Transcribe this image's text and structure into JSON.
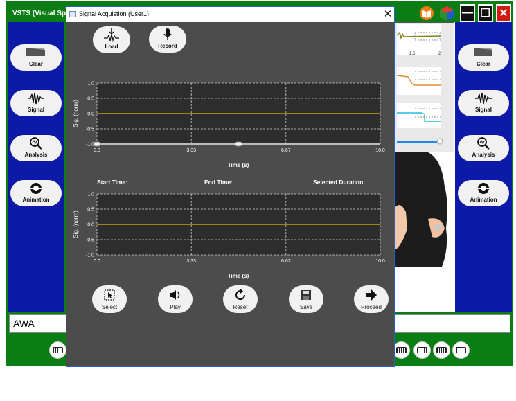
{
  "app": {
    "title": "VSTS (Visual Spee",
    "window_buttons": {
      "help_icon": "book-icon",
      "cube_icon": "cube-icon",
      "min_glyph": "—",
      "max_glyph": "❐",
      "close_glyph": "✕"
    },
    "side_buttons": [
      {
        "label": "Clear",
        "icon": "eraser-icon"
      },
      {
        "label": "Signal",
        "icon": "waveform-icon"
      },
      {
        "label": "Analysis",
        "icon": "magnifier-icon"
      },
      {
        "label": "Animation",
        "icon": "film-icon"
      }
    ],
    "text_box": {
      "value": "AWA"
    },
    "visualization": {
      "tick_labels": [
        "1.6",
        "2"
      ]
    }
  },
  "dialog": {
    "title": "Signal Acquistion (User1)",
    "close_glyph": "✕",
    "top_buttons": [
      {
        "label": "Load",
        "icon": "load-icon"
      },
      {
        "label": "Record",
        "icon": "microphone-icon"
      }
    ],
    "info": {
      "start_time": "Start Time:",
      "end_time": "End Time:",
      "selected_duration": "Selected Duration:"
    },
    "bottom_buttons": [
      {
        "label": "Select",
        "icon": "select-icon"
      },
      {
        "label": "Play",
        "icon": "speaker-icon"
      },
      {
        "label": "Reset",
        "icon": "reset-icon"
      },
      {
        "label": "Save",
        "icon": "save-icon"
      },
      {
        "label": "Proceed",
        "icon": "arrow-right-icon"
      }
    ]
  },
  "colors": {
    "app_bg": "#0b7d15",
    "side_panel": "#0d1aa8",
    "dialog_bg": "#4c4c4c",
    "plot_bg": "#2d2d2d",
    "signal_line": "#c2a30f",
    "slider": "#1e88e5"
  },
  "chart_data": [
    {
      "type": "line",
      "xlabel": "Time (s)",
      "ylabel": "Sig. (norm)",
      "xlim": [
        0,
        10
      ],
      "ylim": [
        -1,
        1
      ],
      "x_ticks": [
        "0.0",
        "3.33",
        "6.67",
        "10.0"
      ],
      "y_ticks": [
        "1.0",
        "0.5",
        "0.0",
        "-0.5",
        "-1.0"
      ],
      "grid": true,
      "series": [
        {
          "x": [
            0,
            10
          ],
          "values": [
            0,
            0
          ]
        }
      ],
      "range_handles": [
        0,
        5
      ]
    },
    {
      "type": "line",
      "xlabel": "Time (s)",
      "ylabel": "Sig. (norm)",
      "xlim": [
        0,
        10
      ],
      "ylim": [
        -1,
        1
      ],
      "x_ticks": [
        "0.0",
        "3.33",
        "6.67",
        "10.0"
      ],
      "y_ticks": [
        "1.0",
        "0.5",
        "0.0",
        "-0.5",
        "-1.0"
      ],
      "grid": true,
      "series": [
        {
          "x": [
            0,
            10
          ],
          "values": [
            0,
            0
          ]
        }
      ]
    }
  ]
}
